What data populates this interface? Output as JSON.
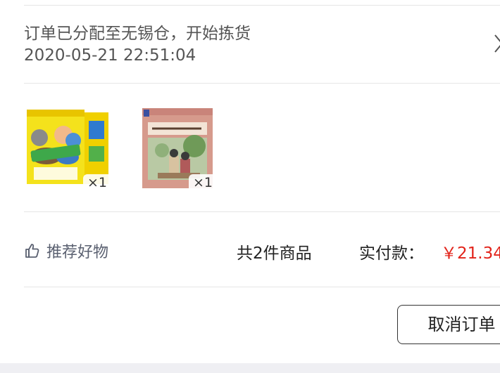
{
  "order_status": {
    "message": "订单已分配至无锡仓，开始拣货",
    "timestamp": "2020-05-21 22:51:04"
  },
  "products": [
    {
      "quantity": "×1"
    },
    {
      "quantity": "×1"
    }
  ],
  "footer": {
    "recommend_label": "推荐好物",
    "item_count_text": "共2件商品",
    "paid_label": "实付款：",
    "paid_amount": "￥21.34"
  },
  "actions": {
    "cancel_order_label": "取消订单"
  },
  "colors": {
    "price": "#e2231a",
    "divider": "#e6e6e6",
    "secondary_text": "#555555"
  }
}
